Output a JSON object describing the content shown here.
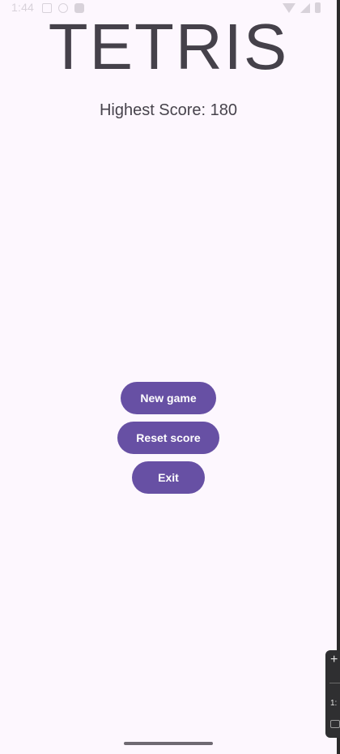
{
  "status_bar": {
    "time": "1:44"
  },
  "header": {
    "title": "TETRIS",
    "highest_score": "Highest Score: 180"
  },
  "menu": {
    "new_game": "New game",
    "reset_score": "Reset score",
    "exit": "Exit"
  },
  "emulator_toolbar": {
    "add_symbol": "+",
    "ratio": "1:"
  },
  "colors": {
    "background": "#fdf7fe",
    "button": "#6750a4",
    "button_text": "#ffffff",
    "title_text": "#45414a"
  }
}
